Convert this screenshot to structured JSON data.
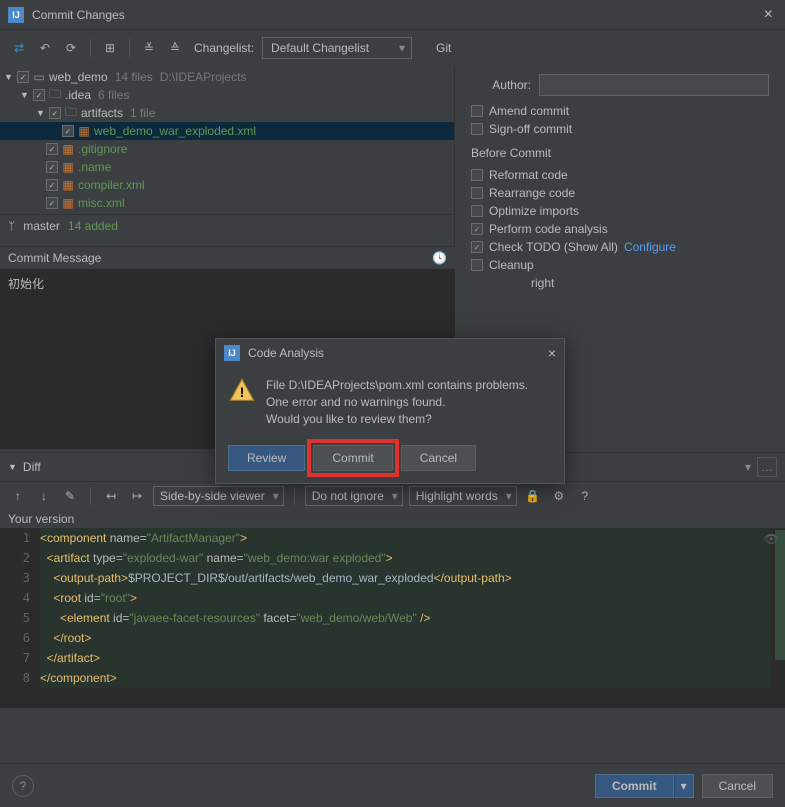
{
  "window": {
    "title": "Commit Changes"
  },
  "toolbar": {
    "changelist_label": "Changelist:",
    "changelist_value": "Default Changelist",
    "git_label": "Git"
  },
  "tree": {
    "root": {
      "name": "web_demo",
      "meta_files": "14 files",
      "meta_path": "D:\\IDEAProjects"
    },
    "idea": {
      "name": ".idea",
      "meta": "6 files"
    },
    "artifacts": {
      "name": "artifacts",
      "meta": "1 file"
    },
    "file_exploded": "web_demo_war_exploded.xml",
    "file_gitignore": ".gitignore",
    "file_name": ".name",
    "file_compiler": "compiler.xml",
    "file_misc": "misc.xml"
  },
  "branch": {
    "name": "master",
    "added": "14 added"
  },
  "author": {
    "label": "Author:"
  },
  "options": {
    "amend": "Amend commit",
    "signoff": "Sign-off commit",
    "before_header": "Before Commit",
    "reformat": "Reformat code",
    "rearrange": "Rearrange code",
    "optimize": "Optimize imports",
    "analysis": "Perform code analysis",
    "todo": "Check TODO (Show All)",
    "todo_link": "Configure",
    "cleanup": "Cleanup",
    "copyright": "right"
  },
  "commit_msg": {
    "label": "Commit Message",
    "value": "初始化"
  },
  "diff": {
    "label": "Diff",
    "viewer": "Side-by-side viewer",
    "ignore": "Do not ignore",
    "highlight": "Highlight words",
    "version": "Your version"
  },
  "code": {
    "l1a": "<component ",
    "l1b": "name",
    "l1c": "=",
    "l1d": "\"ArtifactManager\"",
    "l1e": ">",
    "l2a": "  <artifact ",
    "l2b": "type",
    "l2c": "=",
    "l2d": "\"exploded-war\"",
    "l2e": " name",
    "l2f": "=",
    "l2g": "\"web_demo:war exploded\"",
    "l2h": ">",
    "l3a": "    <output-path>",
    "l3b": "$PROJECT_DIR$/out/artifacts/web_demo_war_exploded",
    "l3c": "</output-path>",
    "l4a": "    <root ",
    "l4b": "id",
    "l4c": "=",
    "l4d": "\"root\"",
    "l4e": ">",
    "l5a": "      <element ",
    "l5b": "id",
    "l5c": "=",
    "l5d": "\"javaee-facet-resources\"",
    "l5e": " facet",
    "l5f": "=",
    "l5g": "\"web_demo/web/Web\"",
    "l5h": " />",
    "l6": "    </root>",
    "l7": "  </artifact>",
    "l8": "</component>"
  },
  "modal": {
    "title": "Code Analysis",
    "line1": "File D:\\IDEAProjects\\pom.xml contains problems.",
    "line2": "One error and no warnings found.",
    "line3": "Would you like to review them?",
    "review": "Review",
    "commit": "Commit",
    "cancel": "Cancel"
  },
  "bottom": {
    "commit": "Commit",
    "cancel": "Cancel"
  }
}
